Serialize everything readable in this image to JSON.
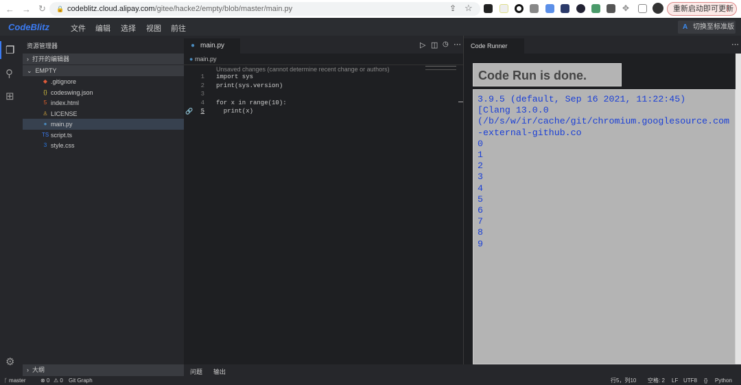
{
  "browser": {
    "url_host": "codeblitz.cloud.alipay.com",
    "url_path": "/gitee/hacke2/empty/blob/master/main.py",
    "update_button": "重新启动即可更新"
  },
  "app": {
    "logo": "CodeBlitz",
    "menu": [
      "文件",
      "编辑",
      "选择",
      "视图",
      "前往"
    ],
    "switch_label": "切换至标准版"
  },
  "sidebar": {
    "title": "资源管理器",
    "open_editors": "打开的编辑器",
    "folder": "EMPTY",
    "outline": "大纲",
    "files": [
      {
        "name": ".gitignore",
        "icon": "◆",
        "color": "#e05b3a"
      },
      {
        "name": "codeswing.json",
        "icon": "{}",
        "color": "#d8c43f"
      },
      {
        "name": "index.html",
        "icon": "5",
        "color": "#e8632a"
      },
      {
        "name": "LICENSE",
        "icon": "♙",
        "color": "#d8a93f"
      },
      {
        "name": "main.py",
        "icon": "●",
        "color": "#4b8bbe"
      },
      {
        "name": "script.ts",
        "icon": "TS",
        "color": "#3b7bf2"
      },
      {
        "name": "style.css",
        "icon": "3",
        "color": "#2a7be8"
      }
    ]
  },
  "editor": {
    "tab": "main.py",
    "breadcrumb": "main.py",
    "blame": "Unsaved changes (cannot determine recent change or authors)",
    "lines": [
      {
        "n": "1",
        "code": "import sys"
      },
      {
        "n": "2",
        "code": "print(sys.version)"
      },
      {
        "n": "3",
        "code": ""
      },
      {
        "n": "4",
        "code": "for x in range(10):"
      },
      {
        "n": "5",
        "code": "  print(x)"
      }
    ]
  },
  "runner": {
    "tab": "Code Runner",
    "done": "Code Run is done.",
    "output": "3.9.5 (default, Sep 16 2021, 11:22:45)\n[Clang 13.0.0\n(/b/s/w/ir/cache/git/chromium.googlesource.com-external-github.co\n0\n1\n2\n3\n4\n5\n6\n7\n8\n9"
  },
  "panel": {
    "problems": "问题",
    "output": "输出"
  },
  "status": {
    "branch": "master",
    "errors": "⊗ 0",
    "warnings": "⚠ 0",
    "git_graph": "Git Graph",
    "position": "行5，列10",
    "spaces": "空格: 2",
    "eol": "LF",
    "encoding": "UTF8",
    "language": "Python"
  }
}
